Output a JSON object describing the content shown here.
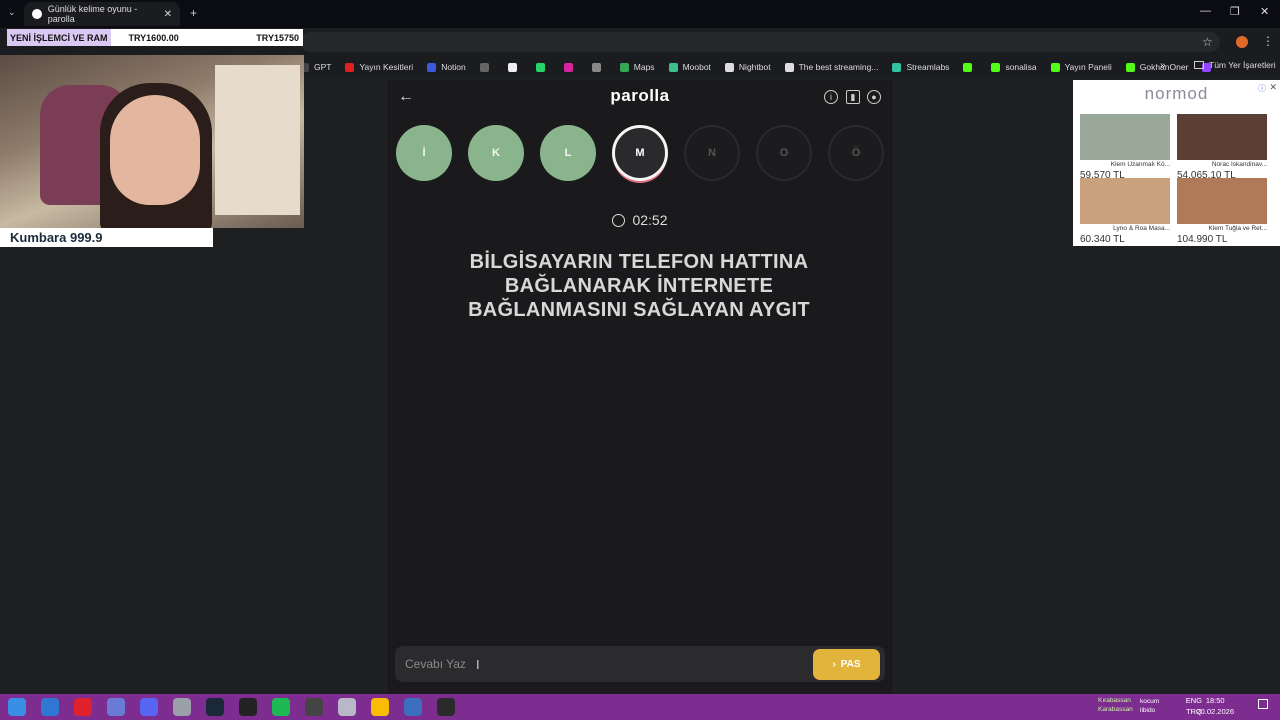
{
  "browser": {
    "tab_title": "Günlük kelime oyunu - parolla",
    "new_tab": "+",
    "bookmarks": [
      {
        "label": "GPT",
        "color": "#444"
      },
      {
        "label": "Yayın Kesitleri",
        "color": "#e02020"
      },
      {
        "label": "Notion",
        "color": "#3b5bdb"
      },
      {
        "label": "",
        "color": "#666"
      },
      {
        "label": "",
        "color": "#eee"
      },
      {
        "label": "",
        "color": "#25d366"
      },
      {
        "label": "",
        "color": "#d6249f"
      },
      {
        "label": "",
        "color": "#888"
      },
      {
        "label": "Maps",
        "color": "#34a853"
      },
      {
        "label": "Moobot",
        "color": "#3fbf8a"
      },
      {
        "label": "Nightbot",
        "color": "#ddd"
      },
      {
        "label": "The best streaming...",
        "color": "#ddd"
      },
      {
        "label": "Streamlabs",
        "color": "#31c3a2"
      },
      {
        "label": "",
        "color": "#53fc18"
      },
      {
        "label": "sonalisa",
        "color": "#53fc18"
      },
      {
        "label": "Yayın Paneli",
        "color": "#53fc18"
      },
      {
        "label": "GokhanOner",
        "color": "#53fc18"
      },
      {
        "label": "",
        "color": "#9146ff"
      }
    ],
    "bookmarks_overflow": "»",
    "all_bookmarks": "Tüm Yer İşaretleri"
  },
  "overlay": {
    "ticker_a": "YENİ İŞLEMCİ VE RAM",
    "ticker_b": "TRY1600.00",
    "ticker_c": "TRY15750",
    "kumbara": "Kumbara 999.9"
  },
  "game": {
    "title": "parolla",
    "letters": [
      {
        "char": "İ",
        "state": "done"
      },
      {
        "char": "K",
        "state": "done"
      },
      {
        "char": "L",
        "state": "done"
      },
      {
        "char": "M",
        "state": "active"
      },
      {
        "char": "N",
        "state": "pending"
      },
      {
        "char": "O",
        "state": "pending"
      },
      {
        "char": "Ö",
        "state": "pending"
      }
    ],
    "timer": "02:52",
    "question": "BİLGİSAYARIN TELEFON HATTINA BAĞLANARAK İNTERNETE BAĞLANMASINI SAĞLAYAN AYGIT",
    "answer_placeholder": "Cevabı Yaz",
    "pass_label": "PAS"
  },
  "ad": {
    "brand": "normod",
    "products": [
      {
        "name": "Klem Uzanmalı Kö...",
        "price": "59.570 TL",
        "color": "#9aa89a"
      },
      {
        "name": "Norac Iskandinav...",
        "price": "54.065,10 TL",
        "color": "#5b3f35"
      },
      {
        "name": "Lyno & Roa Masa...",
        "price": "60.340 TL",
        "color": "#c9a27d"
      },
      {
        "name": "Klem Tuğla ve Ret...",
        "price": "104.990 TL",
        "color": "#b07a58"
      }
    ]
  },
  "taskbar": {
    "icons": [
      "#3a8ee6",
      "#2f78d1",
      "#e0202a",
      "#6a7bd6",
      "#5865f2",
      "#9aa0aa",
      "#1b2838",
      "#222",
      "#1db954",
      "#444",
      "#b8b8c8",
      "#fbbc05",
      "#3d6fbf",
      "#2a2a2a"
    ],
    "tray_text_1": "Kırabassan",
    "tray_text_2": "Karabassan",
    "tray_text_3": "kocum libido",
    "lang_1": "ENG",
    "lang_2": "TRQ",
    "time": "18:50",
    "date": "20.02.2026"
  }
}
